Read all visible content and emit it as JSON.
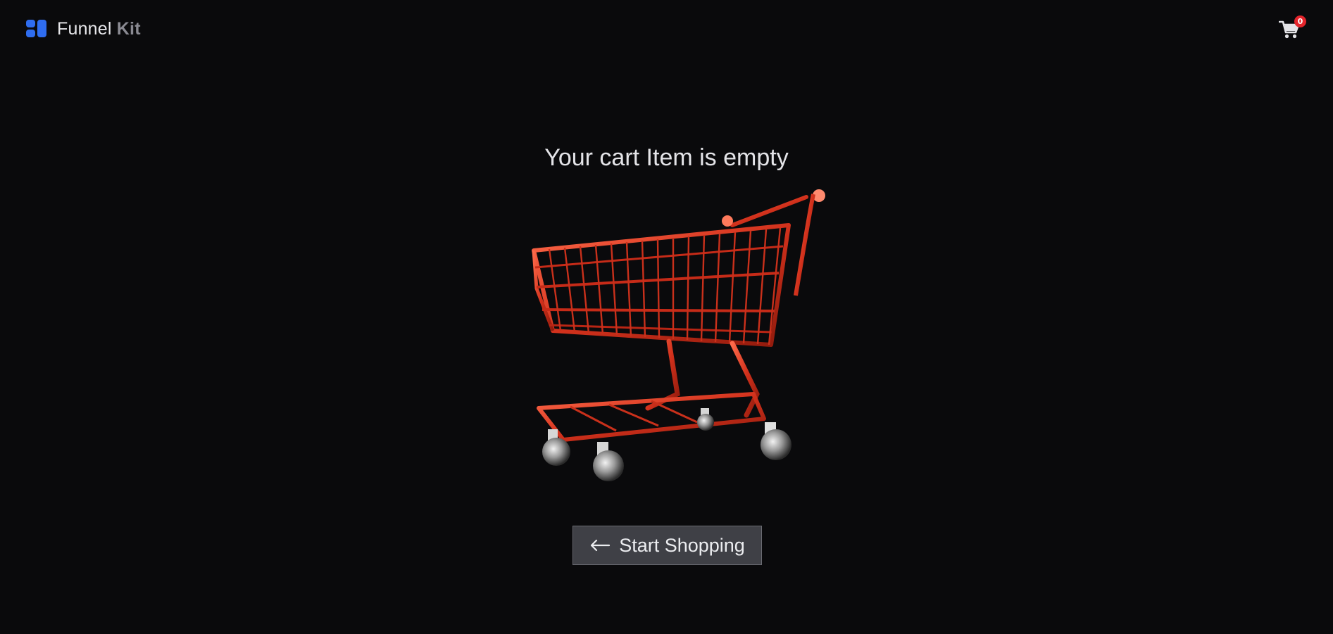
{
  "header": {
    "logo": {
      "word1": "Funnel",
      "word2": "Kit",
      "icon": "logo-mark-icon"
    },
    "cart": {
      "icon": "shopping-cart-icon",
      "count": "0"
    }
  },
  "main": {
    "empty_message": "Your cart Item is empty",
    "illustration": "shopping-cart-illustration",
    "start_button": {
      "label": "Start Shopping",
      "icon": "arrow-left-icon"
    }
  },
  "colors": {
    "background": "#0a0a0c",
    "brand": "#2f6df0",
    "badge": "#e3242b",
    "cart_red": "#d2311c",
    "button_bg": "#3f4046"
  }
}
